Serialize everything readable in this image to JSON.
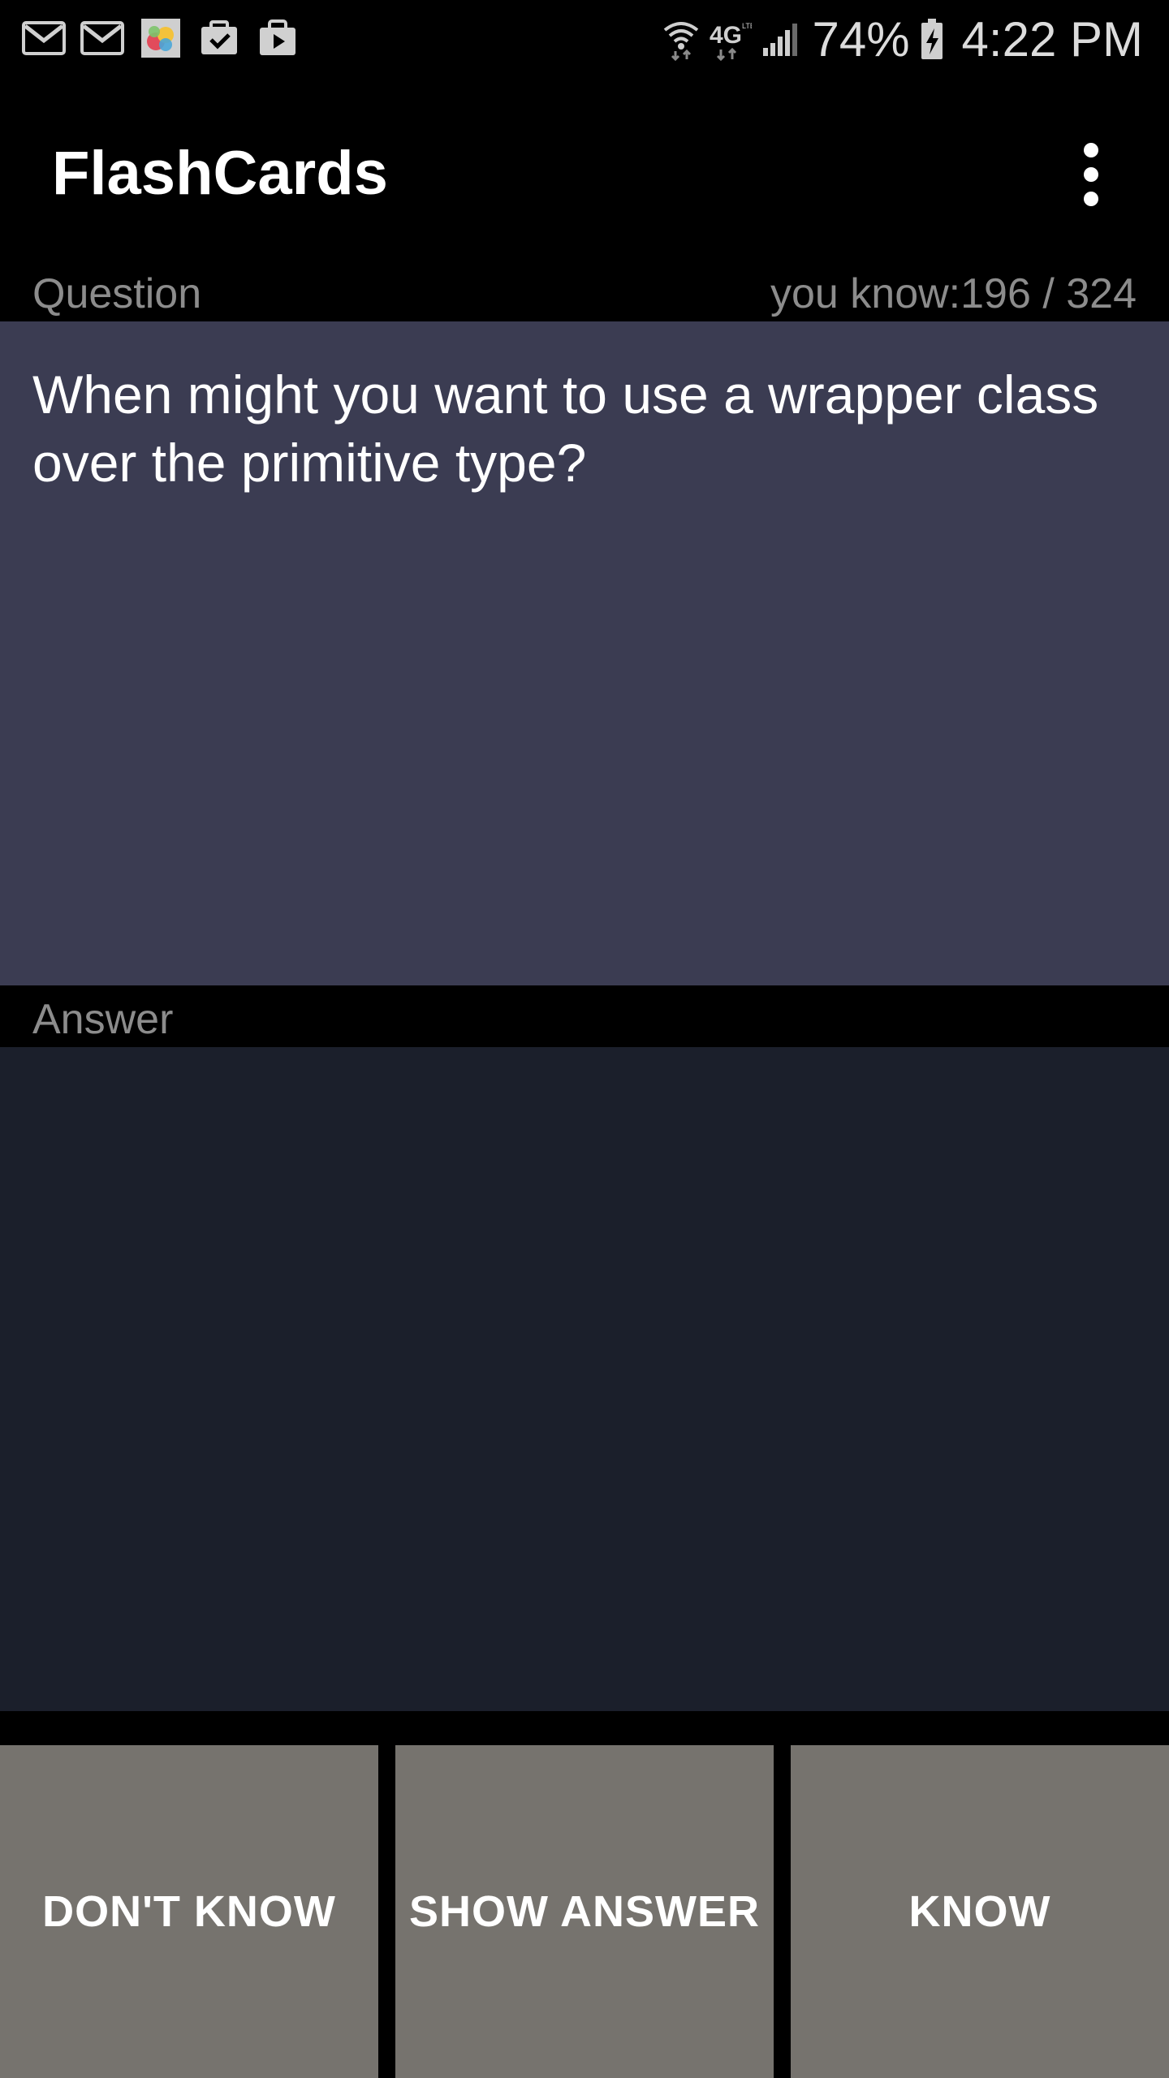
{
  "status_bar": {
    "notification_icons": [
      "gmail-icon",
      "gmail-icon",
      "app-icon",
      "calendar-check-icon",
      "play-store-icon"
    ],
    "network_label": "4G",
    "battery": "74%",
    "time": "4:22 PM"
  },
  "app_bar": {
    "title": "FlashCards",
    "menu_icon": "overflow-menu-icon"
  },
  "question_section": {
    "label": "Question",
    "progress": "you know:196 / 324",
    "text": "When might you want to use a wrapper class over the primitive type?"
  },
  "answer_section": {
    "label": "Answer",
    "text": ""
  },
  "buttons": {
    "dont_know": "DON'T KNOW",
    "show_answer": "SHOW ANSWER",
    "know": "KNOW"
  },
  "colors": {
    "question_card": "#3b3c52",
    "answer_card": "#1b1f2b",
    "button": "#76736e",
    "label_text": "#8c8c8c"
  }
}
